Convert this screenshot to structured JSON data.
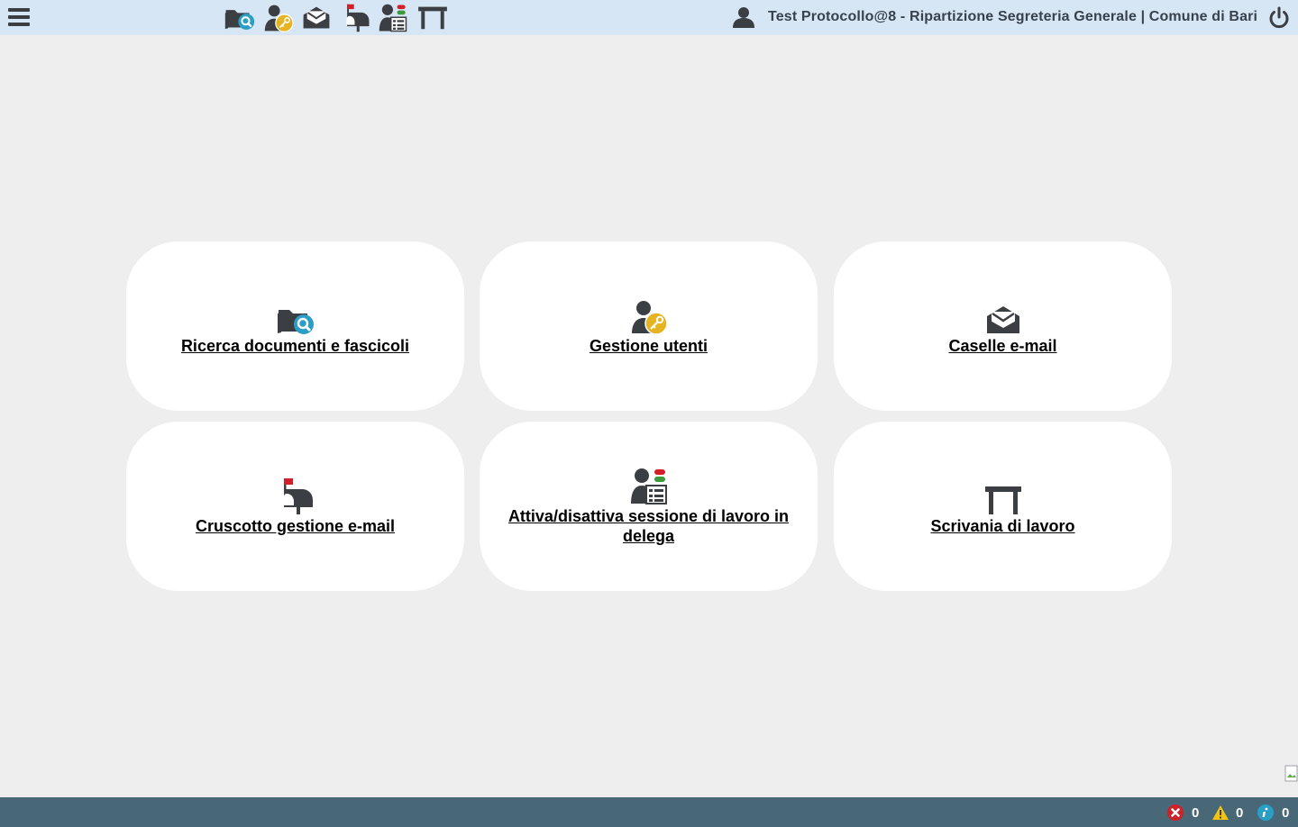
{
  "header": {
    "user_label": "Test Protocollo@8 - Ripartizione Segreteria Generale | Comune di Bari",
    "quick_icons": [
      "folder-search-icon",
      "user-key-icon",
      "envelope-icon",
      "mailbox-icon",
      "delegation-icon",
      "desk-icon"
    ]
  },
  "tiles": [
    {
      "label": "Ricerca documenti e fascicoli",
      "icon": "folder-search-icon"
    },
    {
      "label": "Gestione utenti",
      "icon": "user-key-icon"
    },
    {
      "label": "Caselle e-mail",
      "icon": "envelope-icon"
    },
    {
      "label": "Cruscotto gestione e-mail",
      "icon": "mailbox-icon"
    },
    {
      "label": "Attiva/disattiva sessione di lavoro in delega",
      "icon": "delegation-icon"
    },
    {
      "label": "Scrivania di lavoro",
      "icon": "desk-icon"
    }
  ],
  "status": {
    "errors": "0",
    "warnings": "0",
    "info": "0"
  },
  "colors": {
    "header_bg": "#d6e6f5",
    "page_bg": "#eeeeee",
    "footer_bg": "#486777",
    "icon_dark": "#3b3f44",
    "accent_teal": "#2a9ec4",
    "accent_gold": "#e6b422",
    "flag_red": "#d0202a"
  }
}
